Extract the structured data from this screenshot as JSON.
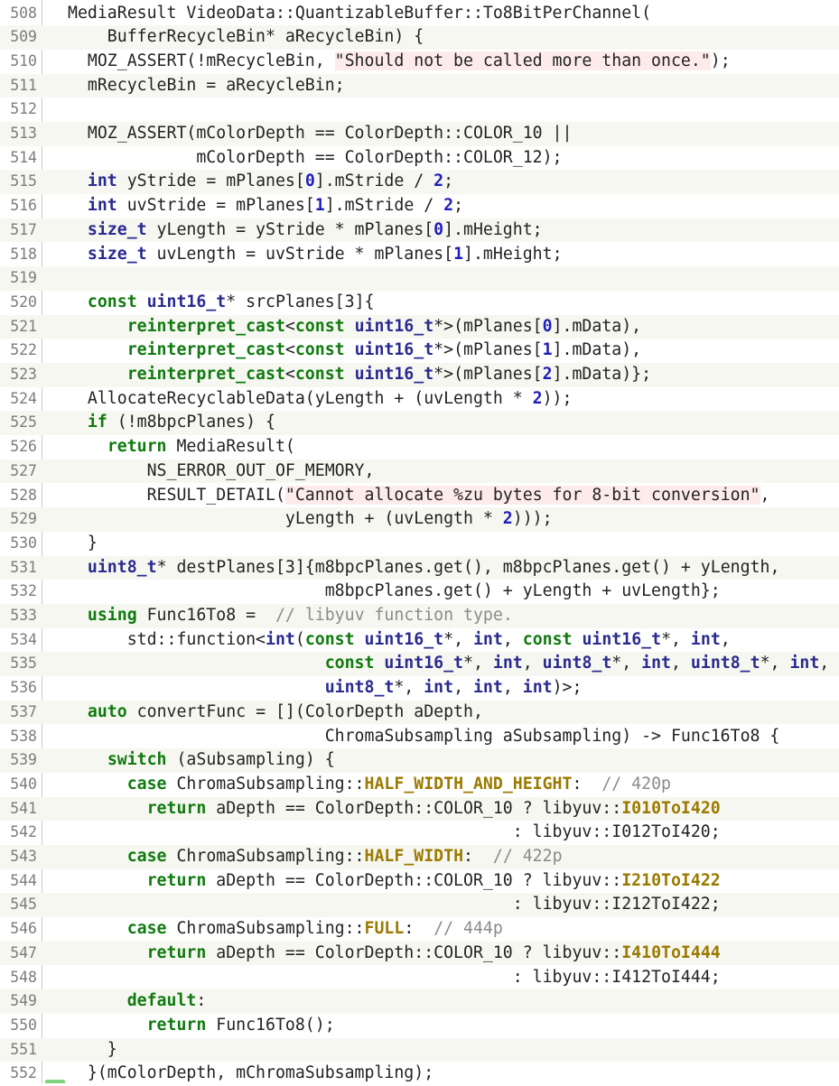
{
  "viewer": {
    "first_line_number": 508,
    "highlight_colors": {
      "keyword": "#0f7a0f",
      "type": "#2a2b8f",
      "number": "#1f1fb8",
      "string_background": "#fdeaea",
      "comment": "#8a8a8a",
      "enum_constant": "#9a7a00",
      "alternate_row_band": "#f7f7f1"
    },
    "lines": [
      {
        "n": "508",
        "tokens": [
          [
            "p",
            "MediaResult VideoData::QuantizableBuffer::To8BitPerChannel("
          ]
        ]
      },
      {
        "n": "509",
        "tokens": [
          [
            "p",
            "    BufferRecycleBin* aRecycleBin) {"
          ]
        ]
      },
      {
        "n": "510",
        "tokens": [
          [
            "p",
            "  MOZ_ASSERT(!mRecycleBin, "
          ],
          [
            "str",
            "\"Should not be called more than once.\""
          ],
          [
            "p",
            ");"
          ]
        ]
      },
      {
        "n": "511",
        "tokens": [
          [
            "p",
            "  mRecycleBin = aRecycleBin;"
          ]
        ]
      },
      {
        "n": "512",
        "tokens": []
      },
      {
        "n": "513",
        "tokens": [
          [
            "p",
            "  MOZ_ASSERT(mColorDepth == ColorDepth::COLOR_10 ||"
          ]
        ]
      },
      {
        "n": "514",
        "tokens": [
          [
            "p",
            "             mColorDepth == ColorDepth::COLOR_12);"
          ]
        ]
      },
      {
        "n": "515",
        "tokens": [
          [
            "p",
            "  "
          ],
          [
            "type",
            "int"
          ],
          [
            "p",
            " yStride = mPlanes["
          ],
          [
            "num",
            "0"
          ],
          [
            "p",
            "].mStride / "
          ],
          [
            "num",
            "2"
          ],
          [
            "p",
            ";"
          ]
        ]
      },
      {
        "n": "516",
        "tokens": [
          [
            "p",
            "  "
          ],
          [
            "type",
            "int"
          ],
          [
            "p",
            " uvStride = mPlanes["
          ],
          [
            "num",
            "1"
          ],
          [
            "p",
            "].mStride / "
          ],
          [
            "num",
            "2"
          ],
          [
            "p",
            ";"
          ]
        ]
      },
      {
        "n": "517",
        "tokens": [
          [
            "p",
            "  "
          ],
          [
            "type",
            "size_t"
          ],
          [
            "p",
            " yLength = yStride * mPlanes["
          ],
          [
            "num",
            "0"
          ],
          [
            "p",
            "].mHeight;"
          ]
        ]
      },
      {
        "n": "518",
        "tokens": [
          [
            "p",
            "  "
          ],
          [
            "type",
            "size_t"
          ],
          [
            "p",
            " uvLength = uvStride * mPlanes["
          ],
          [
            "num",
            "1"
          ],
          [
            "p",
            "].mHeight;"
          ]
        ]
      },
      {
        "n": "519",
        "tokens": []
      },
      {
        "n": "520",
        "tokens": [
          [
            "p",
            "  "
          ],
          [
            "kw",
            "const"
          ],
          [
            "p",
            " "
          ],
          [
            "type",
            "uint16_t"
          ],
          [
            "p",
            "* srcPlanes[3]{"
          ]
        ]
      },
      {
        "n": "521",
        "tokens": [
          [
            "p",
            "      "
          ],
          [
            "kw",
            "reinterpret_cast"
          ],
          [
            "p",
            "<"
          ],
          [
            "kw",
            "const"
          ],
          [
            "p",
            " "
          ],
          [
            "type",
            "uint16_t"
          ],
          [
            "p",
            "*>(mPlanes["
          ],
          [
            "num",
            "0"
          ],
          [
            "p",
            "].mData),"
          ]
        ]
      },
      {
        "n": "522",
        "tokens": [
          [
            "p",
            "      "
          ],
          [
            "kw",
            "reinterpret_cast"
          ],
          [
            "p",
            "<"
          ],
          [
            "kw",
            "const"
          ],
          [
            "p",
            " "
          ],
          [
            "type",
            "uint16_t"
          ],
          [
            "p",
            "*>(mPlanes["
          ],
          [
            "num",
            "1"
          ],
          [
            "p",
            "].mData),"
          ]
        ]
      },
      {
        "n": "523",
        "tokens": [
          [
            "p",
            "      "
          ],
          [
            "kw",
            "reinterpret_cast"
          ],
          [
            "p",
            "<"
          ],
          [
            "kw",
            "const"
          ],
          [
            "p",
            " "
          ],
          [
            "type",
            "uint16_t"
          ],
          [
            "p",
            "*>(mPlanes["
          ],
          [
            "num",
            "2"
          ],
          [
            "p",
            "].mData)};"
          ]
        ]
      },
      {
        "n": "524",
        "tokens": [
          [
            "p",
            "  AllocateRecyclableData(yLength + (uvLength * "
          ],
          [
            "num",
            "2"
          ],
          [
            "p",
            "));"
          ]
        ]
      },
      {
        "n": "525",
        "tokens": [
          [
            "p",
            "  "
          ],
          [
            "kw",
            "if"
          ],
          [
            "p",
            " (!m8bpcPlanes) {"
          ]
        ]
      },
      {
        "n": "526",
        "tokens": [
          [
            "p",
            "    "
          ],
          [
            "kw",
            "return"
          ],
          [
            "p",
            " MediaResult("
          ]
        ]
      },
      {
        "n": "527",
        "tokens": [
          [
            "p",
            "        NS_ERROR_OUT_OF_MEMORY,"
          ]
        ]
      },
      {
        "n": "528",
        "tokens": [
          [
            "p",
            "        RESULT_DETAIL("
          ],
          [
            "str",
            "\"Cannot allocate %zu bytes for 8-bit conversion\""
          ],
          [
            "p",
            ","
          ]
        ]
      },
      {
        "n": "529",
        "tokens": [
          [
            "p",
            "                      yLength + (uvLength * "
          ],
          [
            "num",
            "2"
          ],
          [
            "p",
            ")));"
          ]
        ]
      },
      {
        "n": "530",
        "tokens": [
          [
            "p",
            "  }"
          ]
        ]
      },
      {
        "n": "531",
        "tokens": [
          [
            "p",
            "  "
          ],
          [
            "type",
            "uint8_t"
          ],
          [
            "p",
            "* destPlanes[3]{m8bpcPlanes.get(), m8bpcPlanes.get() + yLength,"
          ]
        ]
      },
      {
        "n": "532",
        "tokens": [
          [
            "p",
            "                          m8bpcPlanes.get() + yLength + uvLength};"
          ]
        ]
      },
      {
        "n": "533",
        "tokens": [
          [
            "p",
            "  "
          ],
          [
            "kw",
            "using"
          ],
          [
            "p",
            " Func16To8 =  "
          ],
          [
            "com",
            "// libyuv function type."
          ]
        ]
      },
      {
        "n": "534",
        "tokens": [
          [
            "p",
            "      std::function<"
          ],
          [
            "type",
            "int"
          ],
          [
            "p",
            "("
          ],
          [
            "kw",
            "const"
          ],
          [
            "p",
            " "
          ],
          [
            "type",
            "uint16_t"
          ],
          [
            "p",
            "*, "
          ],
          [
            "type",
            "int"
          ],
          [
            "p",
            ", "
          ],
          [
            "kw",
            "const"
          ],
          [
            "p",
            " "
          ],
          [
            "type",
            "uint16_t"
          ],
          [
            "p",
            "*, "
          ],
          [
            "type",
            "int"
          ],
          [
            "p",
            ","
          ]
        ]
      },
      {
        "n": "535",
        "tokens": [
          [
            "p",
            "                          "
          ],
          [
            "kw",
            "const"
          ],
          [
            "p",
            " "
          ],
          [
            "type",
            "uint16_t"
          ],
          [
            "p",
            "*, "
          ],
          [
            "type",
            "int"
          ],
          [
            "p",
            ", "
          ],
          [
            "type",
            "uint8_t"
          ],
          [
            "p",
            "*, "
          ],
          [
            "type",
            "int"
          ],
          [
            "p",
            ", "
          ],
          [
            "type",
            "uint8_t"
          ],
          [
            "p",
            "*, "
          ],
          [
            "type",
            "int"
          ],
          [
            "p",
            ","
          ]
        ]
      },
      {
        "n": "536",
        "tokens": [
          [
            "p",
            "                          "
          ],
          [
            "type",
            "uint8_t"
          ],
          [
            "p",
            "*, "
          ],
          [
            "type",
            "int"
          ],
          [
            "p",
            ", "
          ],
          [
            "type",
            "int"
          ],
          [
            "p",
            ", "
          ],
          [
            "type",
            "int"
          ],
          [
            "p",
            ")>;"
          ]
        ]
      },
      {
        "n": "537",
        "tokens": [
          [
            "p",
            "  "
          ],
          [
            "kw",
            "auto"
          ],
          [
            "p",
            " convertFunc = [](ColorDepth aDepth,"
          ]
        ]
      },
      {
        "n": "538",
        "tokens": [
          [
            "p",
            "                          ChromaSubsampling aSubsampling) -> Func16To8 {"
          ]
        ]
      },
      {
        "n": "539",
        "tokens": [
          [
            "p",
            "    "
          ],
          [
            "kw",
            "switch"
          ],
          [
            "p",
            " (aSubsampling) {"
          ]
        ]
      },
      {
        "n": "540",
        "tokens": [
          [
            "p",
            "      "
          ],
          [
            "kw",
            "case"
          ],
          [
            "p",
            " ChromaSubsampling::"
          ],
          [
            "const",
            "HALF_WIDTH_AND_HEIGHT"
          ],
          [
            "p",
            ":  "
          ],
          [
            "com",
            "// 420p"
          ]
        ]
      },
      {
        "n": "541",
        "tokens": [
          [
            "p",
            "        "
          ],
          [
            "kw",
            "return"
          ],
          [
            "p",
            " aDepth == ColorDepth::COLOR_10 ? libyuv::"
          ],
          [
            "const",
            "I010ToI420"
          ]
        ]
      },
      {
        "n": "542",
        "tokens": [
          [
            "p",
            "                                             : libyuv::I012ToI420;"
          ]
        ]
      },
      {
        "n": "543",
        "tokens": [
          [
            "p",
            "      "
          ],
          [
            "kw",
            "case"
          ],
          [
            "p",
            " ChromaSubsampling::"
          ],
          [
            "const",
            "HALF_WIDTH"
          ],
          [
            "p",
            ":  "
          ],
          [
            "com",
            "// 422p"
          ]
        ]
      },
      {
        "n": "544",
        "tokens": [
          [
            "p",
            "        "
          ],
          [
            "kw",
            "return"
          ],
          [
            "p",
            " aDepth == ColorDepth::COLOR_10 ? libyuv::"
          ],
          [
            "const",
            "I210ToI422"
          ]
        ]
      },
      {
        "n": "545",
        "tokens": [
          [
            "p",
            "                                             : libyuv::I212ToI422;"
          ]
        ]
      },
      {
        "n": "546",
        "tokens": [
          [
            "p",
            "      "
          ],
          [
            "kw",
            "case"
          ],
          [
            "p",
            " ChromaSubsampling::"
          ],
          [
            "const",
            "FULL"
          ],
          [
            "p",
            ":  "
          ],
          [
            "com",
            "// 444p"
          ]
        ]
      },
      {
        "n": "547",
        "tokens": [
          [
            "p",
            "        "
          ],
          [
            "kw",
            "return"
          ],
          [
            "p",
            " aDepth == ColorDepth::COLOR_10 ? libyuv::"
          ],
          [
            "const",
            "I410ToI444"
          ]
        ]
      },
      {
        "n": "548",
        "tokens": [
          [
            "p",
            "                                             : libyuv::I412ToI444;"
          ]
        ]
      },
      {
        "n": "549",
        "tokens": [
          [
            "p",
            "      "
          ],
          [
            "kw",
            "default"
          ],
          [
            "p",
            ":"
          ]
        ]
      },
      {
        "n": "550",
        "tokens": [
          [
            "p",
            "        "
          ],
          [
            "kw",
            "return"
          ],
          [
            "p",
            " Func16To8();"
          ]
        ]
      },
      {
        "n": "551",
        "tokens": [
          [
            "p",
            "    }"
          ]
        ]
      },
      {
        "n": "552",
        "tokens": [
          [
            "p",
            "  }(mColorDepth, mChromaSubsampling);"
          ]
        ]
      }
    ]
  }
}
